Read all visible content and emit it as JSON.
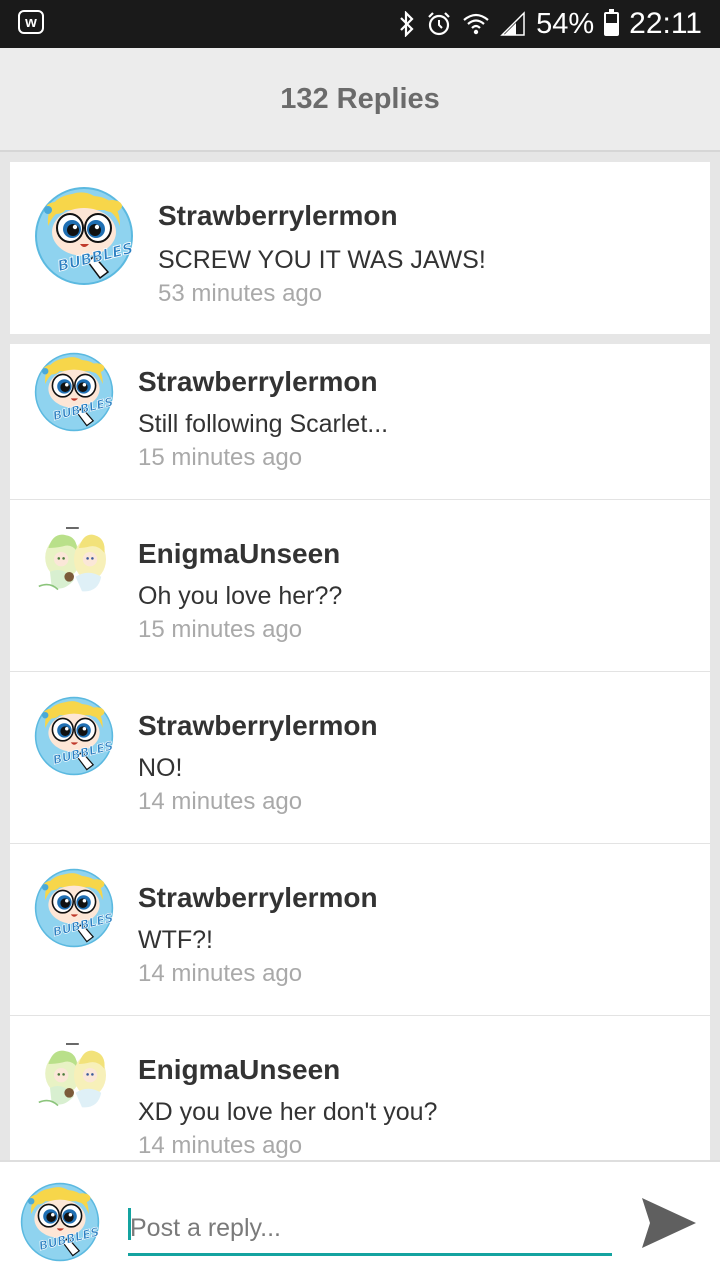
{
  "status_bar": {
    "app_icon": "w-badge-icon",
    "app_letter": "w",
    "icons": [
      "bluetooth-icon",
      "alarm-icon",
      "wifi-icon",
      "signal-icon"
    ],
    "battery_percent": "54%",
    "battery_level": 0.54,
    "time": "22:11"
  },
  "header": {
    "title": "132 Replies"
  },
  "main_comment": {
    "user": "Strawberrylermon",
    "text": "SCREW YOU IT WAS JAWS!",
    "time": "53 minutes ago",
    "avatar_label": "BUBBLES"
  },
  "replies": [
    {
      "user": "Strawberrylermon",
      "text": "Still following Scarlet...",
      "time": "15 minutes ago",
      "avatar": "bubbles"
    },
    {
      "user": "EnigmaUnseen",
      "text": "Oh you love her??",
      "time": "15 minutes ago",
      "avatar": "anime"
    },
    {
      "user": "Strawberrylermon",
      "text": "NO!",
      "time": "14 minutes ago",
      "avatar": "bubbles"
    },
    {
      "user": "Strawberrylermon",
      "text": "WTF?!",
      "time": "14 minutes ago",
      "avatar": "bubbles"
    },
    {
      "user": "EnigmaUnseen",
      "text": "XD you love her don't you?",
      "time": "14 minutes ago",
      "avatar": "anime"
    }
  ],
  "footer": {
    "placeholder": "Post a reply...",
    "value": "",
    "send_icon": "send-icon"
  },
  "colors": {
    "accent": "#14a3a0",
    "status_bar_bg": "#1a1a1a",
    "header_bg": "#ececec",
    "timestamp": "#a9a9a9"
  }
}
